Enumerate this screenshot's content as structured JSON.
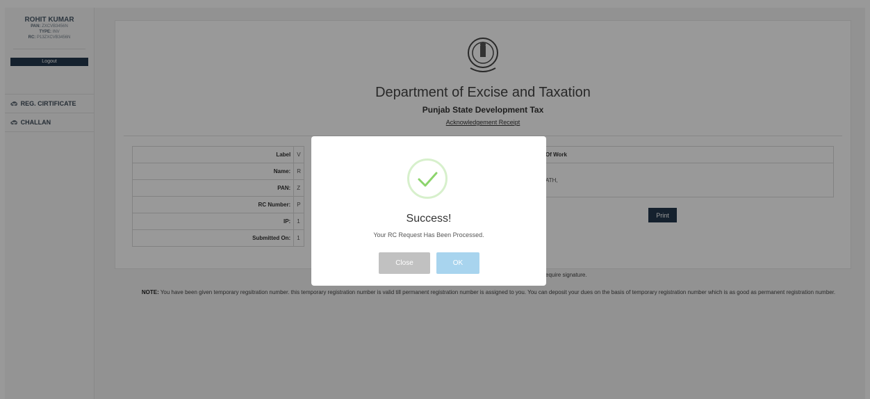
{
  "user": {
    "name": "ROHIT KUMAR",
    "pan_key": "PAN:",
    "pan_value": "ZXCVB3456N",
    "type_key": "TYPE:",
    "type_value": "INV",
    "rc_key": "RC:",
    "rc_value": "P13ZXCVB3456N",
    "logout_label": "Logout"
  },
  "sidebar": {
    "items": [
      {
        "icon": "car-icon",
        "label": "REG. CIRTIFICATE"
      },
      {
        "icon": "car-icon",
        "label": "CHALLAN"
      }
    ]
  },
  "receipt": {
    "emblem_icon": "state-emblem-icon",
    "department": "Department of Excise and Taxation",
    "subtitle": "Punjab State Development Tax",
    "ack": "Acknowledgement Receipt",
    "table": {
      "header_label": "Label",
      "header_value": "V",
      "rows": [
        {
          "label": "Name:",
          "value": "R"
        },
        {
          "label": "PAN:",
          "value": "Z"
        },
        {
          "label": "RC Number:",
          "value": "P"
        },
        {
          "label": "IP:",
          "value": "1"
        },
        {
          "label": "Submitted On:",
          "value": "1"
        }
      ]
    },
    "work": {
      "header": "Of Work",
      "value": "ATH,"
    },
    "print_label": "Print",
    "signature_note": "equire signature."
  },
  "note": {
    "prefix": "NOTE:",
    "text": "You have been given temporary regsitration number. this temporary registration number is valid till permanent registration number is assigned to you. You can deposit your dues on the basis of temporary registration number which is as good as permanent registration number."
  },
  "modal": {
    "icon": "success-check-icon",
    "title": "Success!",
    "message": "Your RC Request Has Been Processed.",
    "close_label": "Close",
    "ok_label": "OK"
  }
}
